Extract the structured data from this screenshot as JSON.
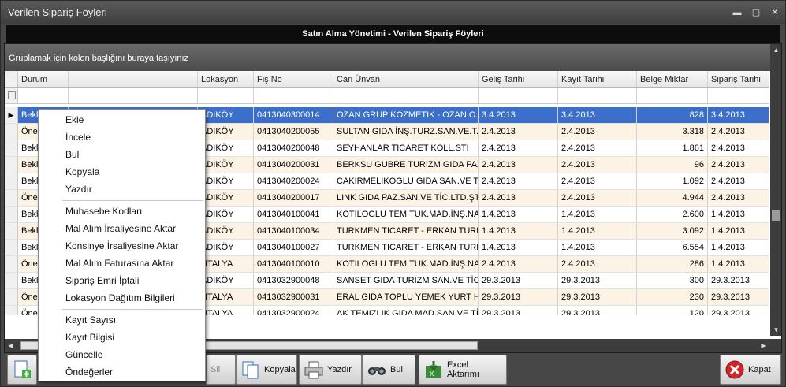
{
  "window": {
    "title": "Verilen Sipariş Föyleri"
  },
  "header_band": "Satın Alma Yönetimi - Verilen Sipariş Föyleri",
  "group_panel": "Gruplamak için kolon başlığını buraya taşıyınız",
  "columns": [
    "Durum",
    "",
    "Lokasyon",
    "Fiş No",
    "Cari Ünvan",
    "Geliş Tarihi",
    "Kayıt Tarihi",
    "Belge Miktar",
    "Sipariş Tarihi"
  ],
  "rows": [
    [
      "Bekle",
      "",
      "ADIKÖY",
      "0413040300014",
      "OZAN GRUP  KOZMETIK - OZAN O...",
      "3.4.2013",
      "3.4.2013",
      "828",
      "3.4.2013"
    ],
    [
      "Öner",
      "",
      "ADIKÖY",
      "0413040200055",
      "SULTAN GIDA İNŞ.TURZ.SAN.VE.T...",
      "2.4.2013",
      "2.4.2013",
      "3.318",
      "2.4.2013"
    ],
    [
      "Bekle",
      "",
      "ADIKÖY",
      "0413040200048",
      "SEYHANLAR TICARET KOLL.STI",
      "2.4.2013",
      "2.4.2013",
      "1.861",
      "2.4.2013"
    ],
    [
      "Bekle",
      "",
      "ADIKÖY",
      "0413040200031",
      "BERKSU GUBRE TURIZM GIDA PAZ...",
      "2.4.2013",
      "2.4.2013",
      "96",
      "2.4.2013"
    ],
    [
      "Bekle",
      "",
      "ADIKÖY",
      "0413040200024",
      "CAKIRMELIKOGLU GIDA SAN.VE TI...",
      "2.4.2013",
      "2.4.2013",
      "1.092",
      "2.4.2013"
    ],
    [
      "Öner",
      "",
      "ADIKÖY",
      "0413040200017",
      "LINK GIDA PAZ.SAN.VE TİC.LTD.ŞTİ",
      "2.4.2013",
      "2.4.2013",
      "4.944",
      "2.4.2013"
    ],
    [
      "Bekle",
      "",
      "ADIKÖY",
      "0413040100041",
      "KOTILOGLU TEM.TUK.MAD.İNŞ.NA...",
      "1.4.2013",
      "1.4.2013",
      "2.600",
      "1.4.2013"
    ],
    [
      "Bekle",
      "",
      "ADIKÖY",
      "0413040100034",
      "TURKMEN TICARET - ERKAN TURK...",
      "1.4.2013",
      "1.4.2013",
      "3.092",
      "1.4.2013"
    ],
    [
      "Bekle",
      "",
      "ADIKÖY",
      "0413040100027",
      "TURKMEN TICARET - ERKAN TURK...",
      "1.4.2013",
      "1.4.2013",
      "6.554",
      "1.4.2013"
    ],
    [
      "Öner",
      "",
      "NTALYA",
      "0413040100010",
      "KOTILOGLU TEM.TUK.MAD.İNŞ.NA...",
      "2.4.2013",
      "2.4.2013",
      "286",
      "1.4.2013"
    ],
    [
      "Bekle",
      "",
      "ADIKÖY",
      "0413032900048",
      "SANSET GIDA TURIZM SAN.VE TİC...",
      "29.3.2013",
      "29.3.2013",
      "300",
      "29.3.2013"
    ],
    [
      "Öner",
      "",
      "NTALYA",
      "0413032900031",
      "ERAL GIDA TOPLU YEMEK YURT HI...",
      "29.3.2013",
      "29.3.2013",
      "230",
      "29.3.2013"
    ],
    [
      "Öner",
      "",
      "NTALYA",
      "0413032900024",
      "AK TEMIZLIK GIDA MAD.SAN.VE TİC...",
      "29.3.2013",
      "29.3.2013",
      "120",
      "29.3.2013"
    ]
  ],
  "context_menu": {
    "group1": [
      "Ekle",
      "İncele",
      "Bul",
      "Kopyala",
      "Yazdır"
    ],
    "group2": [
      "Muhasebe Kodları",
      "Mal Alım İrsaliyesine Aktar",
      "Konsinye İrsaliyesine Aktar",
      "Mal Alım Faturasına Aktar",
      "Sipariş Emri İptali",
      "Lokasyon Dağıtım Bilgileri"
    ],
    "group3": [
      "Kayıt Sayısı",
      "Kayıt Bilgisi",
      "Güncelle",
      "Öndeğerler"
    ]
  },
  "toolbar": {
    "sil": "Sil",
    "kopyala": "Kopyala",
    "yazdir": "Yazdır",
    "bul": "Bul",
    "excel": "Excel Aktarımı",
    "kapat": "Kapat"
  }
}
